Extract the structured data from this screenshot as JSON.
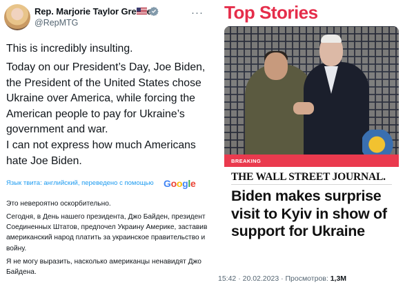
{
  "tweet": {
    "display_name": "Rep. Marjorie Taylor Greene",
    "handle": "@RepMTG",
    "more_icon": "···",
    "text_en": [
      "This is incredibly insulting.",
      "Today on our President’s Day, Joe Biden, the President of the United States chose Ukraine over America, while forcing the American people to pay for Ukraine’s government and war.",
      "I can not express how much Americans hate Joe Biden."
    ],
    "translated_label": "Язык твита: английский, переведено с помощью",
    "translation_provider": "Google",
    "text_ru": [
      "Это невероятно оскорбительно.",
      "Сегодня, в День нашего президента, Джо Байден, президент Соединенных Штатов, предпочел Украину Америке, заставив американский народ платить за украинское правительство и войну.",
      "Я не могу выразить, насколько американцы ненавидят Джо Байдена."
    ],
    "timestamp": "15:42 · 20.02.2023 · Просмотров:",
    "views": "1,3M"
  },
  "media": {
    "section_title": "Top Stories",
    "badge": "BREAKING",
    "publisher": "THE WALL STREET JOURNAL.",
    "headline": "Biden makes surprise visit to Kyiv in show of support for Ukraine"
  },
  "colors": {
    "accent_red": "#e52d4a",
    "link_blue": "#1d9bf0",
    "muted_gray": "#536471"
  },
  "icons": [
    "avatar",
    "us-flag-icon",
    "verified-badge-icon",
    "more-icon",
    "google-logo"
  ]
}
